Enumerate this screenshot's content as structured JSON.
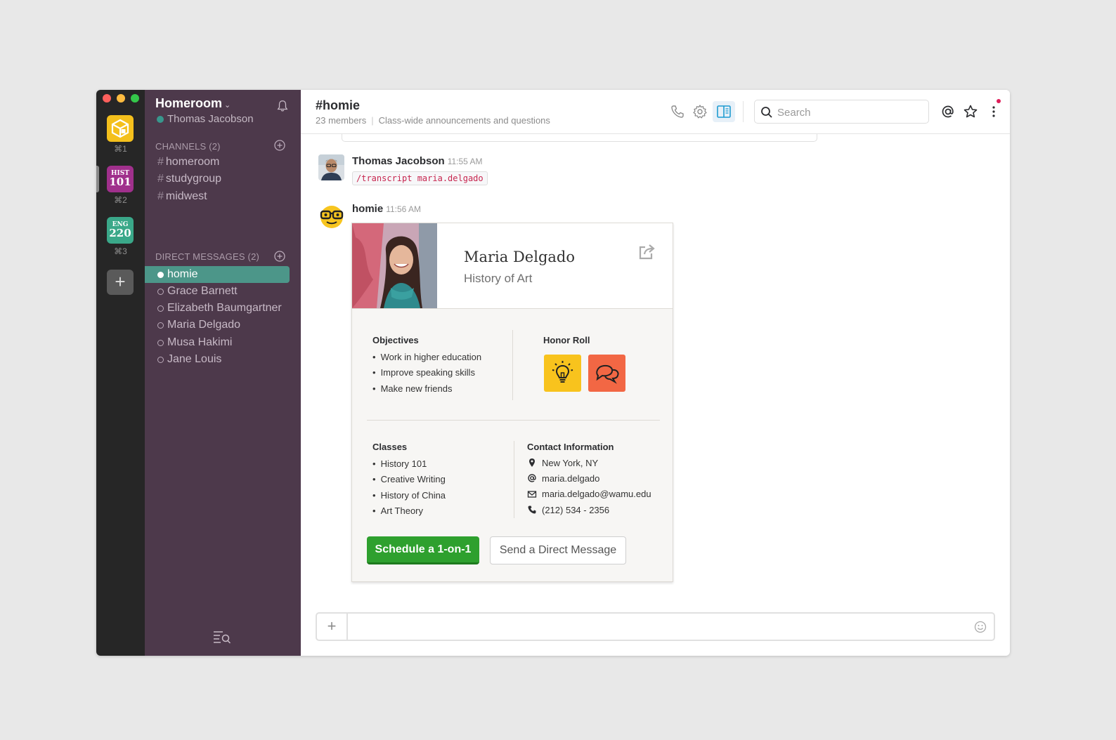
{
  "team": {
    "name": "Homeroom",
    "user": "Thomas Jacobson"
  },
  "team_switcher": [
    {
      "line1": "",
      "line2": "",
      "shortcut": "⌘1",
      "color": "#f4c01c"
    },
    {
      "line1": "HIST",
      "line2": "101",
      "shortcut": "⌘2",
      "color": "#a0308c"
    },
    {
      "line1": "ENG",
      "line2": "220",
      "shortcut": "⌘3",
      "color": "#3aa889"
    }
  ],
  "sidebar": {
    "channels_heading": "CHANNELS (2)",
    "channels": [
      "homeroom",
      "studygroup",
      "midwest"
    ],
    "dm_heading": "DIRECT MESSAGES (2)",
    "dms": [
      "homie",
      "Grace Barnett",
      "Elizabeth Baumgartner",
      "Maria Delgado",
      "Musa Hakimi",
      "Jane Louis"
    ],
    "active_dm": "homie"
  },
  "channel": {
    "name": "#homie",
    "members": "23 members",
    "purpose": "Class-wide announcements and questions"
  },
  "search": {
    "placeholder": "Search"
  },
  "messages": [
    {
      "author": "Thomas Jacobson",
      "time": "11:55 AM",
      "code": "/transcript maria.delgado"
    },
    {
      "author": "homie",
      "time": "11:56 AM"
    }
  ],
  "card": {
    "name": "Maria Delgado",
    "subtitle": "History of Art",
    "objectives_title": "Objectives",
    "objectives": [
      "Work in higher education",
      "Improve speaking skills",
      "Make new friends"
    ],
    "honor_title": "Honor Roll",
    "honor_badges": [
      {
        "icon": "lightbulb-icon",
        "color": "#f8c31d"
      },
      {
        "icon": "speech-bubbles-icon",
        "color": "#f26744"
      }
    ],
    "classes_title": "Classes",
    "classes": [
      "History 101",
      "Creative Writing",
      "History of China",
      "Art Theory"
    ],
    "contact_title": "Contact Information",
    "contact": {
      "location": "New York, NY",
      "handle": "maria.delgado",
      "email": "maria.delgado@wamu.edu",
      "phone": "(212) 534 - 2356"
    },
    "primary_button": "Schedule a 1-on-1",
    "secondary_button": "Send a Direct Message"
  },
  "colors": {
    "sidebar_bg": "#4d394b",
    "active_item": "#4c9689",
    "primary_button": "#2ea02e",
    "accent": "#1d9bd1"
  }
}
